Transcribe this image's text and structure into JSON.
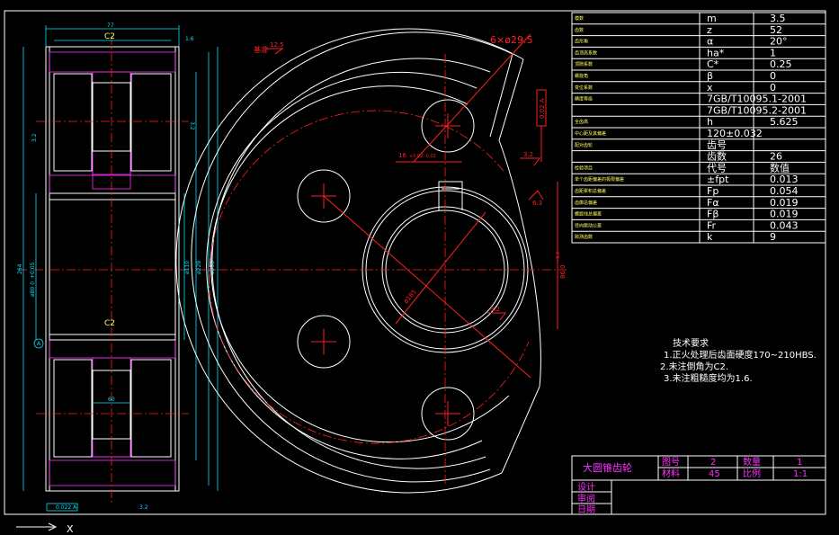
{
  "side_view": {
    "top_width": "77",
    "chamfer_top": "C2",
    "chamfer_mid": "C2",
    "angle_top": "1.6",
    "dia_labels": [
      "264",
      "ø80 0",
      "ø110",
      "ø229",
      "ø258"
    ],
    "small_dim": "3.2",
    "hub_width": "60",
    "runout_tol": "0.022 A",
    "datum": "A",
    "rough_bottom": "3.2",
    "small_left": "3.2",
    "dim_plus": "+0.05"
  },
  "front_view": {
    "holes_label": "6×ø29.5",
    "bolt_circle": "ø185",
    "keyway_width": "16",
    "keyway_tol": "+0.02 -0.02",
    "keyway_depth": "86.0",
    "keyway_depth_tol": "+0.2",
    "rough_a": "3.2",
    "rough_b": "3.2",
    "rough_c": "6.3",
    "rough_d": "3.2",
    "tol_box": "0.02 A",
    "red_mark": "基准",
    "red_rough": "12.5"
  },
  "param_table": {
    "rows": [
      {
        "name": "模数",
        "sym": "m",
        "val": "3.5"
      },
      {
        "name": "齿数",
        "sym": "z",
        "val": "52"
      },
      {
        "name": "齿形角",
        "sym": "α",
        "val": "20°"
      },
      {
        "name": "齿顶高系数",
        "sym": "ha*",
        "val": "1"
      },
      {
        "name": "顶隙系数",
        "sym": "C*",
        "val": "0.25"
      },
      {
        "name": "螺旋角",
        "sym": "β",
        "val": "0"
      },
      {
        "name": "变位系数",
        "sym": "x",
        "val": "0"
      },
      {
        "name": "精度等级",
        "sym": "",
        "val": "7GB/T10095.1-2001"
      },
      {
        "name": "",
        "sym": "",
        "val": "7GB/T10095.2-2001"
      },
      {
        "name": "全齿高",
        "sym": "h",
        "val": "5.625"
      },
      {
        "name": "中心距及其偏差",
        "sym": "",
        "val": "120±0.032"
      },
      {
        "name": "配对齿轮",
        "sym": "齿号",
        "val": ""
      },
      {
        "name": "",
        "sym": "齿数",
        "val": "26"
      },
      {
        "name": "检验项目",
        "sym": "代号",
        "val": "数值"
      },
      {
        "name": "单个齿距偏差的极限偏差",
        "sym": "±fpt",
        "val": "0.013"
      },
      {
        "name": "齿距累积总偏差",
        "sym": "Fp",
        "val": "0.054"
      },
      {
        "name": "齿廓总偏差",
        "sym": "Fα",
        "val": "0.019"
      },
      {
        "name": "螺旋线总偏差",
        "sym": "Fβ",
        "val": "0.019"
      },
      {
        "name": "径向跳动公差",
        "sym": "Fr",
        "val": "0.043"
      },
      {
        "name": "跨测齿数",
        "sym": "k",
        "val": "9"
      }
    ]
  },
  "tech_req": {
    "title": "技术要求",
    "items": [
      "1.正火处理后齿面硬度170~210HBS.",
      "2.未注倒角为C2.",
      "3.未注粗糙度均为1.6."
    ]
  },
  "title_block": {
    "part_name": "大圆锥齿轮",
    "drawing_no_label": "图号",
    "drawing_no": "2",
    "qty_label": "数量",
    "qty": "1",
    "material_label": "材料",
    "material": "45",
    "scale_label": "比例",
    "scale": "1:1",
    "design": "设计",
    "check": "审阅",
    "date": "日期"
  },
  "colors": {
    "background": "#000000",
    "line": "#ffffff",
    "centerline": "#ff2020",
    "hatch": "#ff30ff",
    "dimension": "#00e5ff",
    "text_yellow": "#ffff60"
  }
}
